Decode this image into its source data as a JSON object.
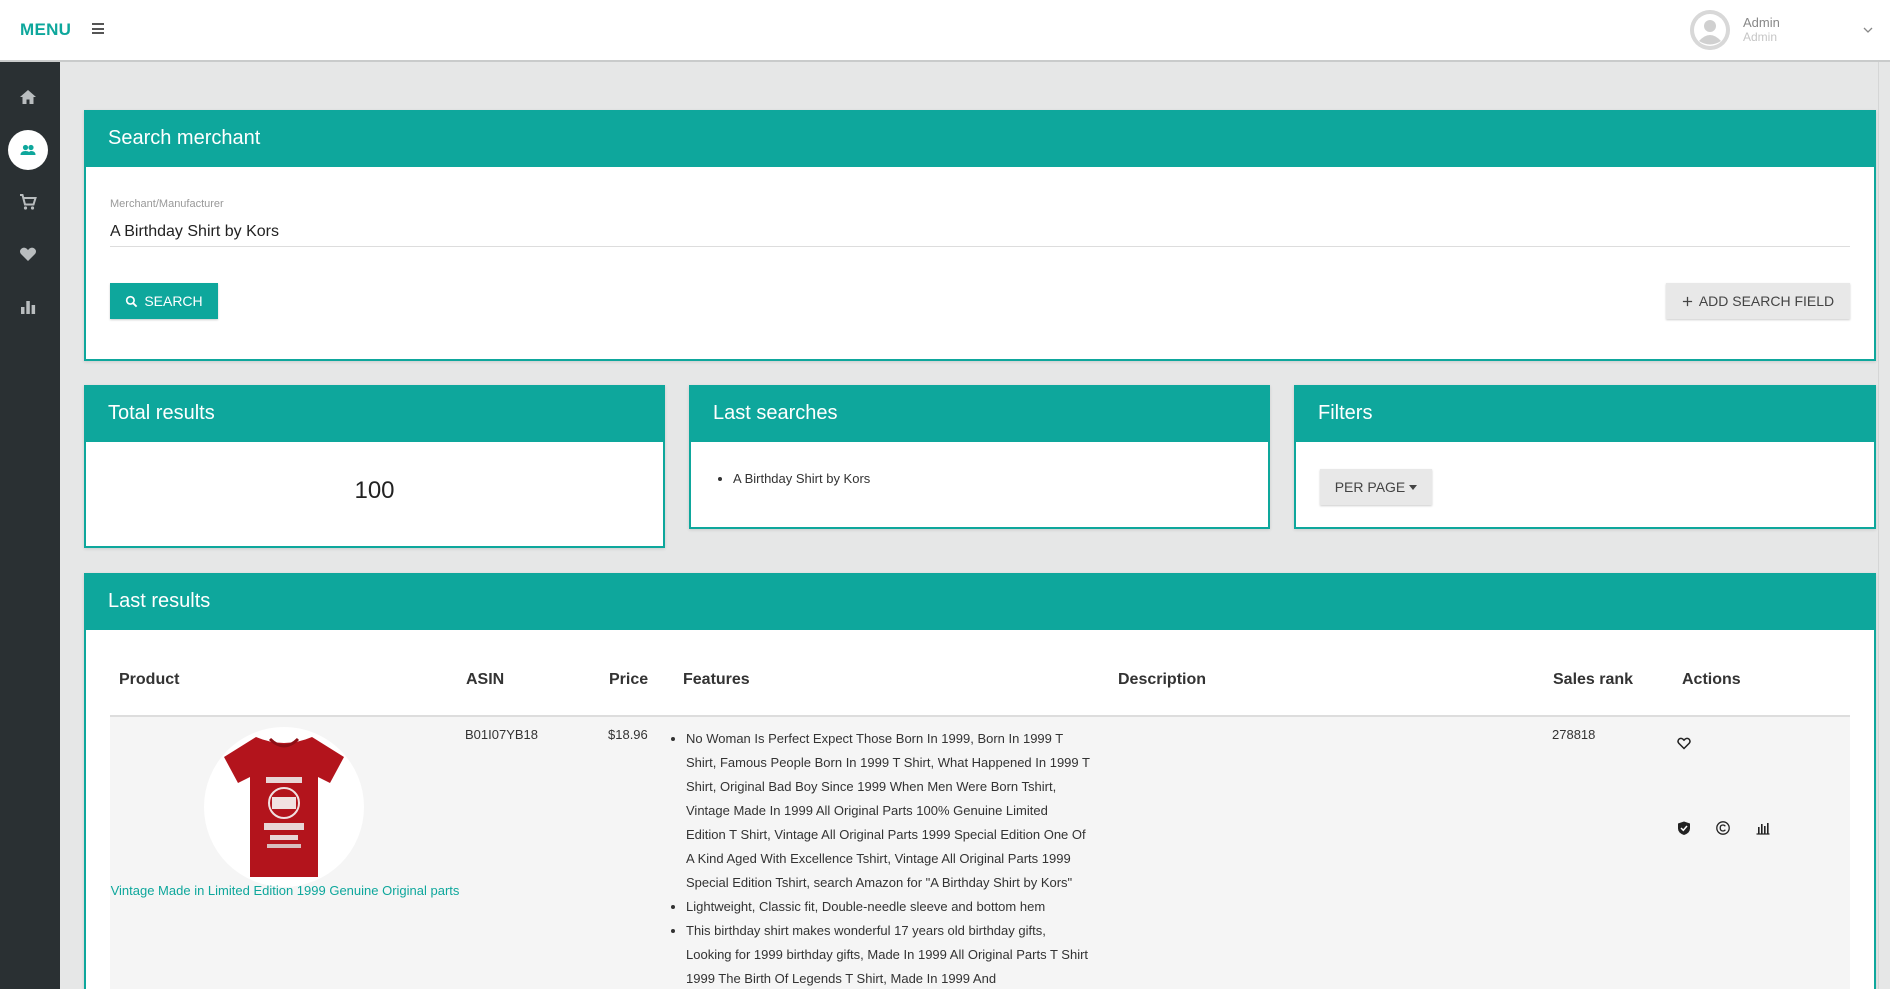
{
  "topbar": {
    "menu_label": "MENU",
    "user_name": "Admin",
    "user_role": "Admin"
  },
  "sidebar": {
    "items": [
      {
        "icon": "home-icon"
      },
      {
        "icon": "users-icon",
        "active": true
      },
      {
        "icon": "cart-icon"
      },
      {
        "icon": "heart-icon"
      },
      {
        "icon": "bar-chart-icon"
      }
    ]
  },
  "search_card": {
    "title": "Search merchant",
    "field_label": "Merchant/Manufacturer",
    "field_value": "A Birthday Shirt by Kors",
    "search_label": "SEARCH",
    "add_field_label": "ADD SEARCH FIELD"
  },
  "total_card": {
    "title": "Total results",
    "value": "100"
  },
  "last_searches_card": {
    "title": "Last searches",
    "items": [
      "A Birthday Shirt by Kors"
    ]
  },
  "filters_card": {
    "title": "Filters",
    "per_page_label": "PER PAGE"
  },
  "results_card": {
    "title": "Last results",
    "columns": [
      "Product",
      "ASIN",
      "Price",
      "Features",
      "Description",
      "Sales rank",
      "Actions"
    ],
    "rows": [
      {
        "product_title": "Vintage Made in Limited Edition 1999 Genuine Original parts",
        "asin": "B01I07YB18",
        "price": "$18.96",
        "features": [
          "No Woman Is Perfect Expect Those Born In 1999, Born In 1999 T Shirt, Famous People Born In 1999 T Shirt, What Happened In 1999 T Shirt, Original Bad Boy Since 1999 When Men Were Born Tshirt, Vintage Made In 1999 All Original Parts 100% Genuine Limited Edition T Shirt, Vintage All Original Parts 1999 Special Edition One Of A Kind Aged With Excellence Tshirt, Vintage All Original Parts 1999 Special Edition Tshirt, search Amazon for \"A Birthday Shirt by Kors\"",
          "Lightweight, Classic fit, Double-needle sleeve and bottom hem",
          "This birthday shirt makes wonderful 17 years old birthday gifts, Looking for 1999 birthday gifts, Made In 1999 All Original Parts T Shirt 1999 The Birth Of Legends T Shirt, Made In 1999 And"
        ],
        "description": "",
        "sales_rank": "278818"
      }
    ]
  },
  "colors": {
    "accent": "#0ea79c",
    "sidebar": "#2a3033",
    "background": "#e6e7e7",
    "shirt": "#b3141c"
  }
}
